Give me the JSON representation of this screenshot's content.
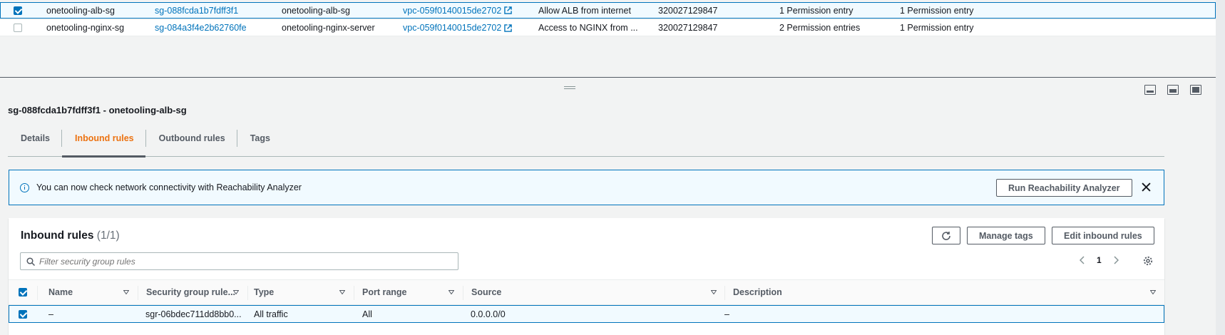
{
  "security_groups": [
    {
      "selected": true,
      "name": "onetooling-alb-sg",
      "group_id": "sg-088fcda1b7fdff3f1",
      "group_name": "onetooling-alb-sg",
      "vpc_id": "vpc-059f0140015de2702",
      "description": "Allow ALB from internet",
      "owner": "320027129847",
      "inbound_count": "1 Permission entry",
      "outbound_count": "1 Permission entry"
    },
    {
      "selected": false,
      "name": "onetooling-nginx-sg",
      "group_id": "sg-084a3f4e2b62760fe",
      "group_name": "onetooling-nginx-server",
      "vpc_id": "vpc-059f0140015de2702",
      "description": "Access to NGINX from ...",
      "owner": "320027129847",
      "inbound_count": "2 Permission entries",
      "outbound_count": "1 Permission entry"
    }
  ],
  "details_panel": {
    "title": "sg-088fcda1b7fdff3f1 - onetooling-alb-sg",
    "tabs": [
      {
        "label": "Details",
        "active": false
      },
      {
        "label": "Inbound rules",
        "active": true
      },
      {
        "label": "Outbound rules",
        "active": false
      },
      {
        "label": "Tags",
        "active": false
      }
    ],
    "banner": {
      "text": "You can now check network connectivity with Reachability Analyzer",
      "button_label": "Run Reachability Analyzer"
    },
    "inbound_rules": {
      "title": "Inbound rules",
      "count": "(1/1)",
      "manage_tags_label": "Manage tags",
      "edit_label": "Edit inbound rules",
      "filter_placeholder": "Filter security group rules",
      "current_page": "1",
      "columns": [
        "Name",
        "Security group rule...",
        "Type",
        "Port range",
        "Source",
        "Description"
      ],
      "rows": [
        {
          "selected": true,
          "name": "–",
          "rule_id": "sgr-06bdec711dd8bb0...",
          "type": "All traffic",
          "port_range": "All",
          "source": "0.0.0.0/0",
          "description": "–"
        }
      ]
    }
  },
  "colors": {
    "link": "#0073bb",
    "active_tab": "#ec7211",
    "selection_border": "#0073bb"
  }
}
